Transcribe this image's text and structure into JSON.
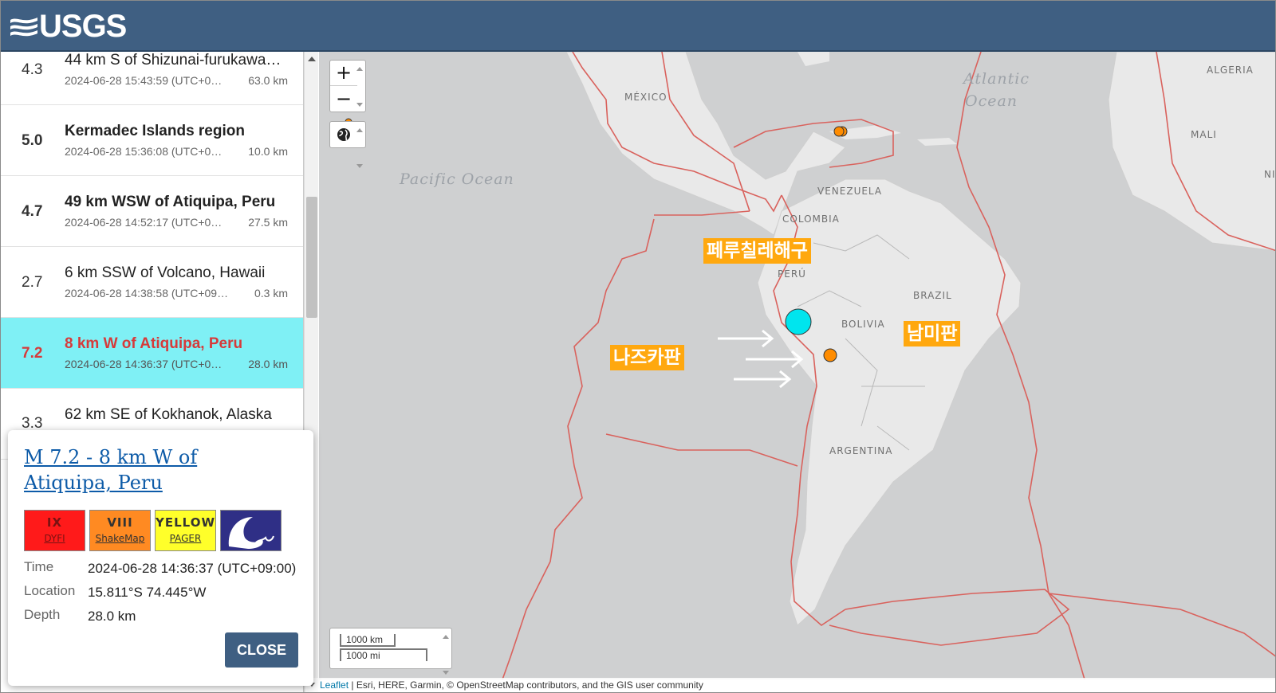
{
  "header": {
    "logo_text": "USGS"
  },
  "earthquakes": [
    {
      "mag": "4.3",
      "place": "44 km S of Shizunai-furukawa…",
      "time": "2024-06-28 15:43:59 (UTC+0…",
      "depth": "63.0 km",
      "bold": false,
      "selected": false
    },
    {
      "mag": "5.0",
      "place": "Kermadec Islands region",
      "time": "2024-06-28 15:36:08 (UTC+0…",
      "depth": "10.0 km",
      "bold": true,
      "selected": false
    },
    {
      "mag": "4.7",
      "place": "49 km WSW of Atiquipa, Peru",
      "time": "2024-06-28 14:52:17 (UTC+0…",
      "depth": "27.5 km",
      "bold": true,
      "selected": false
    },
    {
      "mag": "2.7",
      "place": "6 km SSW of Volcano, Hawaii",
      "time": "2024-06-28 14:38:58 (UTC+09…",
      "depth": "0.3 km",
      "bold": false,
      "selected": false
    },
    {
      "mag": "7.2",
      "place": "8 km W of Atiquipa, Peru",
      "time": "2024-06-28 14:36:37 (UTC+0…",
      "depth": "28.0 km",
      "bold": true,
      "selected": true
    },
    {
      "mag": "3.3",
      "place": "62 km SE of Kokhanok, Alaska",
      "time": "",
      "depth": "",
      "bold": false,
      "selected": false
    }
  ],
  "map": {
    "labels": {
      "mexico": "MÉXICO",
      "venezuela": "VENEZUELA",
      "colombia": "COLOMBIA",
      "peru": "PERÚ",
      "bolivia": "BOLIVIA",
      "brazil": "BRAZIL",
      "argentina": "ARGENTINA",
      "algeria": "ALGERIA",
      "mali": "MALI",
      "ni": "NI"
    },
    "oceans": {
      "pacific": "Pacific Ocean",
      "atlantic_1": "Atlantic",
      "atlantic_2": "Ocean"
    },
    "annotations": {
      "trench": "페루칠레해구",
      "nazca": "나즈카판",
      "south_american": "남미판"
    },
    "controls": {
      "zoom_in": "+",
      "zoom_out": "−",
      "scale_km": "1000 km",
      "scale_mi": "1000 mi"
    },
    "attribution": {
      "leaflet": "Leaflet",
      "rest": " | Esri, HERE, Garmin, © OpenStreetMap contributors, and the GIS user community"
    },
    "colors": {
      "plate_boundary": "#d9625d",
      "selected_marker": "#00e5ee",
      "marker": "#ff8c00"
    }
  },
  "popup": {
    "title": "M 7.2 - 8 km W of Atiquipa, Peru",
    "badges": {
      "dyfi_value": "IX",
      "dyfi_label": "DYFI",
      "shakemap_value": "VIII",
      "shakemap_label": "ShakeMap",
      "pager_value": "YELLOW",
      "pager_label": "PAGER",
      "tsunami_icon": "tsunami-icon"
    },
    "fields": [
      {
        "label": "Time",
        "value": "2024-06-28 14:36:37 (UTC+09:00)"
      },
      {
        "label": "Location",
        "value": "15.811°S 74.445°W"
      },
      {
        "label": "Depth",
        "value": "28.0 km"
      }
    ],
    "close_label": "CLOSE"
  }
}
